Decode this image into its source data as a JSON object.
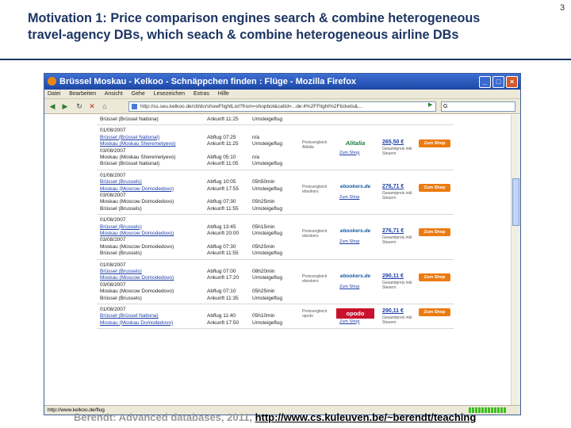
{
  "slide": {
    "number": "3",
    "title_line1": "Motivation 1: Price comparison engines search & combine heterogeneous",
    "title_line2": "travel-agency DBs, which seach & combine heterogeneous airline DBs",
    "footer_text": "Berendt: Advanced databases, 2011, ",
    "footer_link": "http://www.cs.kuleuven.be/~berendt/teaching"
  },
  "browser": {
    "title": "Brüssel Moskau - Kelkoo - Schnäppchen finden : Flüge - Mozilla Firefox",
    "menu": [
      "Datei",
      "Bearbeiten",
      "Ansicht",
      "Gehe",
      "Lesezeichen",
      "Extras",
      "Hilfe"
    ],
    "url": "http://ss.seu.kelkoo.de/ctl/do/showFlightList?from=shopbot&catId=...de:4%2FFlight%2Ftickets&...",
    "search_value": "G",
    "status_text": "http://www.kelkoo.de/flug"
  },
  "flights": [
    {
      "lines": [
        {
          "date": "Brüssel (Brüssel Nationa)",
          "time": "Ankunft 11:25",
          "dur": "Umsteigeflug",
          "date_link": false
        }
      ]
    },
    {
      "lines": [
        {
          "date": "01/08/2007",
          "time": "",
          "dur": ""
        },
        {
          "date": "Brüssel (Brüssel National)",
          "time": "Abflug 07:25",
          "dur": "n/a",
          "date_link": true
        },
        {
          "date": "Moskau (Moskau Sheremetyevo)",
          "time": "Ankunft 11:25",
          "dur": "Umsteigeflug",
          "date_link": true
        },
        {
          "date": "03/08/2007",
          "time": "",
          "dur": ""
        },
        {
          "date": "Moskau (Moskau Sheremetyevo)",
          "time": "Abflug 05:10",
          "dur": "n/a"
        },
        {
          "date": "Brüssel (Brüssel National)",
          "time": "Ankunft 11:05",
          "dur": "Umsteigeflug"
        }
      ],
      "service": "Preisvergleich Alitalia",
      "logo": "Alitalia",
      "logo_link": "Zum Shop",
      "price": "265,50 €",
      "price_note": "Gesamtpreis inkl. Steuern",
      "button": "Zum Shop"
    },
    {
      "lines": [
        {
          "date": "01/08/2007",
          "time": "",
          "dur": ""
        },
        {
          "date": "Brüssel (Brussels)",
          "time": "Abflug 10:05",
          "dur": "05h50min",
          "date_link": true
        },
        {
          "date": "Moskau (Moscow Domodedovo)",
          "time": "Ankunft 17:55",
          "dur": "Umsteigeflug",
          "date_link": true
        },
        {
          "date": "03/08/2007",
          "time": "",
          "dur": ""
        },
        {
          "date": "Moskau (Moscow Domodedovo)",
          "time": "Abflug 07:30",
          "dur": "05h25min"
        },
        {
          "date": "Brüssel (Brussels)",
          "time": "Ankunft 11:55",
          "dur": "Umsteigeflug"
        }
      ],
      "service": "Preisvergleich ebookers",
      "logo": "ebookers.de",
      "logo_link": "Zum Shop",
      "price": "276,71 €",
      "price_note": "Gesamtpreis inkl. Steuern",
      "button": "Zum Shop"
    },
    {
      "lines": [
        {
          "date": "01/08/2007",
          "time": "",
          "dur": ""
        },
        {
          "date": "Brüssel (Brussels)",
          "time": "Abflug 13:45",
          "dur": "05h15min",
          "date_link": true
        },
        {
          "date": "Moskau (Moscow Domodedovo)",
          "time": "Ankunft 20:00",
          "dur": "Umsteigeflug",
          "date_link": true
        },
        {
          "date": "03/08/2007",
          "time": "",
          "dur": ""
        },
        {
          "date": "Moskau (Moscow Domodedovo)",
          "time": "Abflug 07:30",
          "dur": "05h25min"
        },
        {
          "date": "Brüssel (Brussels)",
          "time": "Ankunft 11:55",
          "dur": "Umsteigeflug"
        }
      ],
      "service": "Preisvergleich ebookers",
      "logo": "ebookers.de",
      "logo_link": "Zum Shop",
      "price": "276,71 €",
      "price_note": "Gesamtpreis inkl. Steuern",
      "button": "Zum Shop"
    },
    {
      "lines": [
        {
          "date": "01/08/2007",
          "time": "",
          "dur": ""
        },
        {
          "date": "Brüssel (Brussels)",
          "time": "Abflug 07:00",
          "dur": "08h20min",
          "date_link": true
        },
        {
          "date": "Moskau (Moscow Domodedovo)",
          "time": "Ankunft 17:20",
          "dur": "Umsteigeflug",
          "date_link": true
        },
        {
          "date": "03/08/2007",
          "time": "",
          "dur": ""
        },
        {
          "date": "Moskau (Moscow Domodedovo)",
          "time": "Abflug 07:10",
          "dur": "05h25min"
        },
        {
          "date": "Brüssel (Brussels)",
          "time": "Ankunft 11:35",
          "dur": "Umsteigeflug"
        }
      ],
      "service": "Preisvergleich ebookers",
      "logo": "ebookers.de",
      "logo_link": "Zum Shop",
      "price": "290,11 €",
      "price_note": "Gesamtpreis inkl. Steuern",
      "button": "Zum Shop"
    },
    {
      "lines": [
        {
          "date": "01/08/2007",
          "time": "",
          "dur": ""
        },
        {
          "date": "Brüssel (Brüssel Nationa)",
          "time": "Abflug 11:40",
          "dur": "05h10min",
          "date_link": true
        },
        {
          "date": "Moskau (Moskau Domodedovo)",
          "time": "Ankunft 17:50",
          "dur": "Umsteigeflug",
          "date_link": true
        }
      ],
      "service": "Preisvergleich opodo",
      "logo": "opodo",
      "logo_link": "Zum Shop",
      "price": "290,11 €",
      "price_note": "Gesamtpreis inkl. Steuern",
      "button": "Zum Shop"
    }
  ]
}
